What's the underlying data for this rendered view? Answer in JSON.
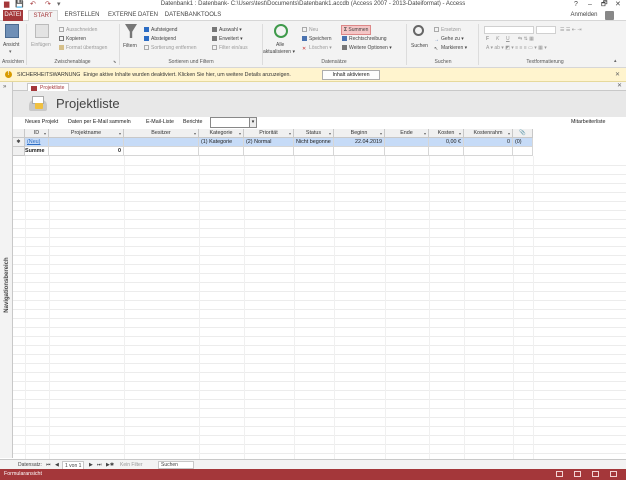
{
  "window": {
    "title": "Datenbank1 : Datenbank- C:\\Users\\test\\Documents\\Datenbank1.accdb (Access 2007 - 2013-Dateiformat) - Access",
    "user": "Anmelden",
    "help": "?",
    "minimize": "–",
    "restore": "🗗",
    "close": "✕"
  },
  "tabs": [
    "DATEI",
    "START",
    "ERSTELLEN",
    "EXTERNE DATEN",
    "DATENBANKTOOLS"
  ],
  "ribbon": {
    "ansichten": {
      "view_label": "Ansicht",
      "group": "Ansichten"
    },
    "zwischenablage": {
      "paste_label": "Einfügen",
      "cut": "Ausschneiden",
      "copy": "Kopieren",
      "format_painter": "Format übertragen",
      "group": "Zwischenablage"
    },
    "sortieren": {
      "filter_label": "Filtern",
      "ascending": "Aufsteigend",
      "descending": "Absteigend",
      "remove_sort": "Sortierung entfernen",
      "selection": "Auswahl",
      "advanced": "Erweitert",
      "toggle_filter": "Filter ein/aus",
      "group": "Sortieren und Filtern"
    },
    "datensaetze": {
      "refresh_label": "Alle aktualisieren",
      "new": "Neu",
      "save": "Speichern",
      "delete": "Löschen",
      "totals": "Summen",
      "spelling": "Rechtschreibung",
      "more": "Weitere Optionen",
      "group": "Datensätze"
    },
    "suchen": {
      "find_label": "Suchen",
      "replace": "Ersetzen",
      "goto": "Gehe zu",
      "select": "Markieren",
      "group": "Suchen"
    },
    "textformatierung": {
      "group": "Textformatierung",
      "buttons": [
        "F",
        "K",
        "U"
      ]
    }
  },
  "warning": {
    "title": "SICHERHEITSWARNUNG",
    "message": "Einige aktive Inhalte wurden deaktiviert. Klicken Sie hier, um weitere Details anzuzeigen.",
    "button": "Inhalt aktivieren"
  },
  "nav_pane": {
    "label": "Navigationsbereich",
    "toggle": "»"
  },
  "document": {
    "tab_label": "Projektliste",
    "form_title": "Projektliste",
    "links": [
      "Neues Projekt",
      "Daten per E-Mail sammeln",
      "E-Mail-Liste",
      "Berichte"
    ],
    "right_link": "Mitarbeiterliste"
  },
  "grid": {
    "columns": [
      "ID",
      "Projektname",
      "Besitzer",
      "Kategorie",
      "Priorität",
      "Status",
      "Beginn",
      "Ende",
      "Kosten",
      "Kostenrahm",
      "📎"
    ],
    "new_row": [
      "(Neu)",
      "",
      "",
      "(1) Kategorie",
      "(2) Normal",
      "Nicht begonne",
      "22.04.2019",
      "",
      "0,00 €",
      "0",
      "(0)"
    ],
    "total_row": {
      "label": "Summe",
      "value": "0"
    },
    "new_row_marker": "✱"
  },
  "record_nav": {
    "label": "Datensatz:",
    "first": "⏮",
    "prev": "◀",
    "position": "1 von 1",
    "next": "▶",
    "last": "⏭",
    "new": "▶✱",
    "no_filter": "Kein Filter",
    "search": "Suchen"
  },
  "status": {
    "text": "Formularansicht"
  },
  "colors": {
    "accent": "#a4373a",
    "warning_bg": "#fff4ce",
    "selected_row": "#c6dbf7"
  }
}
